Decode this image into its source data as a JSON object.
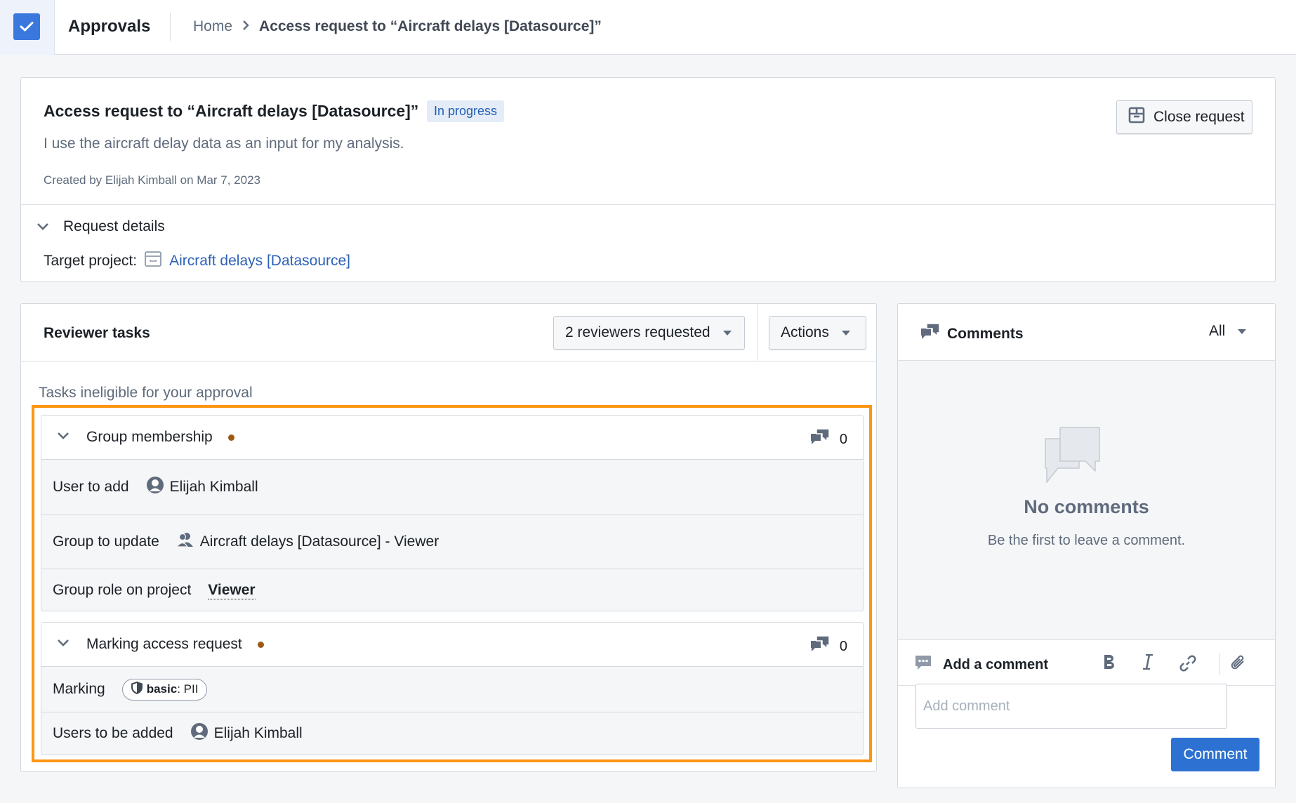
{
  "app": {
    "title": "Approvals",
    "brand_color": "#3b78de"
  },
  "breadcrumb": {
    "home": "Home",
    "separator": "›",
    "current": "Access request to “Aircraft delays [Datasource]”"
  },
  "request": {
    "title": "Access request to “Aircraft delays [Datasource]”",
    "status": "In progress",
    "description": "I use the aircraft delay data as an input for my analysis.",
    "created": "Created by Elijah Kimball on Mar 7, 2023",
    "close_button": "Close request",
    "details_label": "Request details",
    "target_label": "Target project:",
    "target_value": "Aircraft delays [Datasource]"
  },
  "reviewer": {
    "title": "Reviewer tasks",
    "reviewers_dropdown": "2 reviewers requested",
    "actions_dropdown": "Actions",
    "ineligible_label": "Tasks ineligible for your approval",
    "highlight_color": "#ff9613",
    "tasks": [
      {
        "name": "Group membership",
        "comment_count": "0",
        "rows": [
          {
            "label": "User to add",
            "value": "Elijah Kimball"
          },
          {
            "label": "Group to update",
            "value": "Aircraft delays [Datasource] - Viewer"
          },
          {
            "label": "Group role on project",
            "value": "Viewer"
          }
        ]
      },
      {
        "name": "Marking access request",
        "comment_count": "0",
        "rows": [
          {
            "label": "Marking",
            "tag_prefix": "basic",
            "tag_value": ": PII"
          },
          {
            "label": "Users to be added",
            "value": "Elijah Kimball"
          }
        ]
      }
    ]
  },
  "comments": {
    "title": "Comments",
    "filter": "All",
    "empty_title": "No comments",
    "empty_subtitle": "Be the first to leave a comment.",
    "compose_title": "Add a comment",
    "input_placeholder": "Add comment",
    "input_value": "",
    "submit": "Comment",
    "format_buttons": [
      "bold",
      "italic",
      "link",
      "attachment"
    ]
  }
}
